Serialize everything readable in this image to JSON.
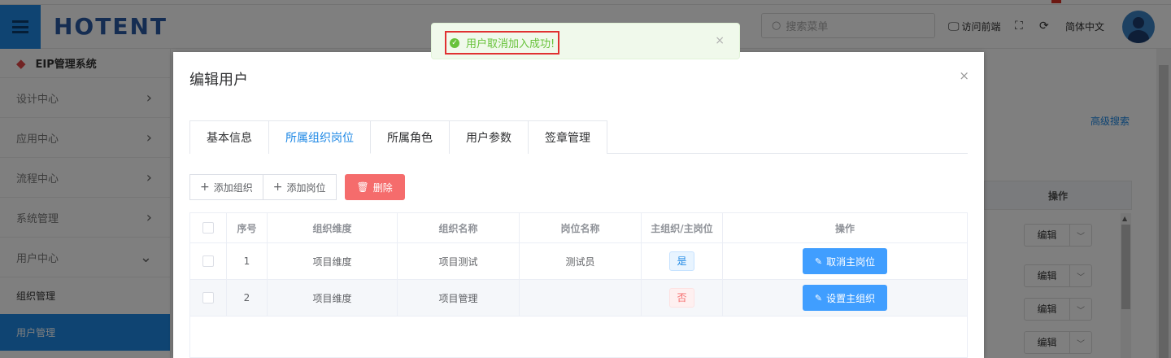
{
  "header": {
    "logo": "HOTENT",
    "search_placeholder": "搜索菜单",
    "visit_front": "访问前端",
    "language": "简体中文"
  },
  "sidebar": {
    "system_title": "EIP管理系统",
    "menu": [
      {
        "label": "设计中心"
      },
      {
        "label": "应用中心"
      },
      {
        "label": "流程中心"
      },
      {
        "label": "系统管理"
      },
      {
        "label": "用户中心"
      }
    ],
    "submenu": [
      {
        "label": "组织管理"
      },
      {
        "label": "用户管理",
        "active": true
      }
    ]
  },
  "background": {
    "advanced_search": "高级搜索",
    "table_header_op": "操作",
    "edit_label": "编辑"
  },
  "dialog": {
    "title": "编辑用户",
    "close": "×",
    "tabs": [
      {
        "label": "基本信息"
      },
      {
        "label": "所属组织岗位",
        "active": true
      },
      {
        "label": "所属角色"
      },
      {
        "label": "用户参数"
      },
      {
        "label": "签章管理"
      }
    ],
    "toolbar": {
      "add_org": "添加组织",
      "add_post": "添加岗位",
      "delete": "删除"
    },
    "table": {
      "headers": [
        "序号",
        "组织维度",
        "组织名称",
        "岗位名称",
        "主组织/主岗位",
        "操作"
      ],
      "rows": [
        {
          "index": "1",
          "dimension": "项目维度",
          "org_name": "项目测试",
          "post_name": "测试员",
          "is_main": "是",
          "action": "取消主岗位"
        },
        {
          "index": "2",
          "dimension": "项目维度",
          "org_name": "项目管理",
          "post_name": "",
          "is_main": "否",
          "action": "设置主组织"
        }
      ]
    }
  },
  "toast": {
    "message": "用户取消加入成功!",
    "close": "×"
  },
  "colors": {
    "primary": "#1e88e5",
    "danger": "#f56c6c",
    "success": "#67c23a"
  }
}
